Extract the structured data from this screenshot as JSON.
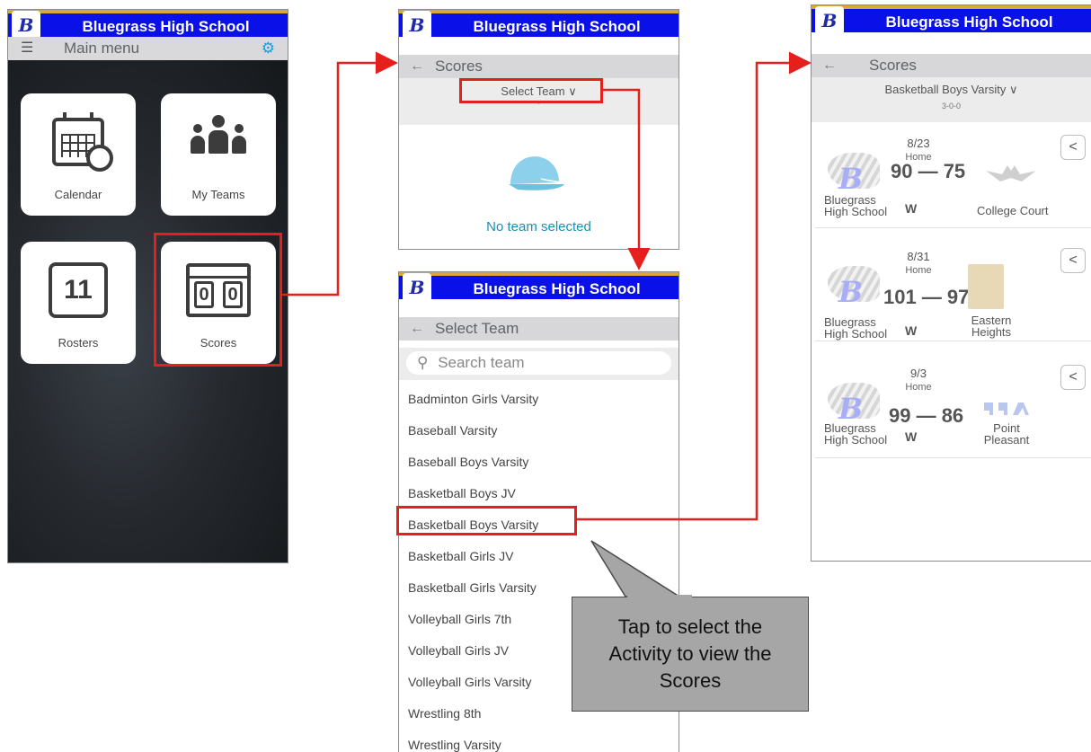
{
  "app": {
    "school_name": "Bluegrass High School",
    "logo_letter": "B"
  },
  "main_menu": {
    "title": "Main menu",
    "tiles": [
      {
        "label": "Calendar",
        "icon": "calendar-icon"
      },
      {
        "label": "My Teams",
        "icon": "people-icon"
      },
      {
        "label": "Rosters",
        "icon": "jersey-icon"
      },
      {
        "label": "Scores",
        "icon": "scoreboard-icon",
        "board_digits": [
          "0",
          "0"
        ],
        "jersey_number": "11"
      }
    ]
  },
  "scores_empty": {
    "title": "Scores",
    "select_label": "Select Team ∨",
    "dot": "-",
    "empty_text": "No team selected"
  },
  "select_team": {
    "title": "Select Team",
    "search_placeholder": "Search team",
    "teams": [
      "Badminton Girls Varsity",
      "Baseball Varsity",
      "Baseball Boys Varsity",
      "Basketball Boys JV",
      "Basketball Boys Varsity",
      "Basketball Girls JV",
      "Basketball Girls Varsity",
      "Volleyball Girls 7th",
      "Volleyball Girls JV",
      "Volleyball Girls Varsity",
      "Wrestling 8th",
      "Wrestling Varsity"
    ],
    "selected_index": 4
  },
  "scores_team": {
    "title": "Scores",
    "team_label": "Basketball Boys Varsity ∨",
    "record": "3-0-0",
    "games": [
      {
        "date": "8/23",
        "location": "Home",
        "score": "90 — 75",
        "result": "W",
        "home_team": "Bluegrass High School",
        "opponent": "College Court"
      },
      {
        "date": "8/31",
        "location": "Home",
        "score": "101 — 97",
        "result": "W",
        "home_team": "Bluegrass High School",
        "opponent": "Eastern Heights"
      },
      {
        "date": "9/3",
        "location": "Home",
        "score": "99 — 86",
        "result": "W",
        "home_team": "Bluegrass High School",
        "opponent": "Point Pleasant"
      }
    ]
  },
  "callout": {
    "text": "Tap to select the Activity to view the Scores"
  },
  "colors": {
    "appbar": "#0a10e8",
    "highlight": "#e5201c",
    "accent": "#1a9fd8"
  }
}
